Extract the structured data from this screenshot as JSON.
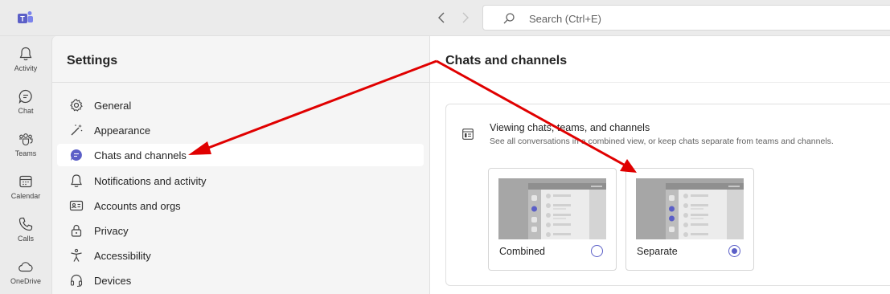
{
  "search": {
    "placeholder": "Search (Ctrl+E)"
  },
  "rail": {
    "items": [
      {
        "label": "Activity",
        "icon": "bell-icon"
      },
      {
        "label": "Chat",
        "icon": "chat-icon"
      },
      {
        "label": "Teams",
        "icon": "teams-icon"
      },
      {
        "label": "Calendar",
        "icon": "calendar-icon"
      },
      {
        "label": "Calls",
        "icon": "phone-icon"
      },
      {
        "label": "OneDrive",
        "icon": "cloud-icon"
      }
    ]
  },
  "settings": {
    "title": "Settings",
    "items": [
      {
        "label": "General",
        "icon": "gear-icon"
      },
      {
        "label": "Appearance",
        "icon": "wand-icon"
      },
      {
        "label": "Chats and channels",
        "icon": "chat-bubble-icon",
        "active": true
      },
      {
        "label": "Notifications and activity",
        "icon": "bell-icon"
      },
      {
        "label": "Accounts and orgs",
        "icon": "id-card-icon"
      },
      {
        "label": "Privacy",
        "icon": "lock-icon"
      },
      {
        "label": "Accessibility",
        "icon": "accessibility-icon"
      },
      {
        "label": "Devices",
        "icon": "headset-icon"
      }
    ]
  },
  "main": {
    "title": "Chats and channels",
    "card": {
      "heading": "Viewing chats, teams, and channels",
      "description": "See all conversations in a combined view, or keep chats separate from teams and channels.",
      "options": [
        {
          "label": "Combined",
          "selected": false
        },
        {
          "label": "Separate",
          "selected": true
        }
      ]
    }
  },
  "colors": {
    "accent": "#5b5fc7",
    "annotation_arrow": "#e00000"
  }
}
